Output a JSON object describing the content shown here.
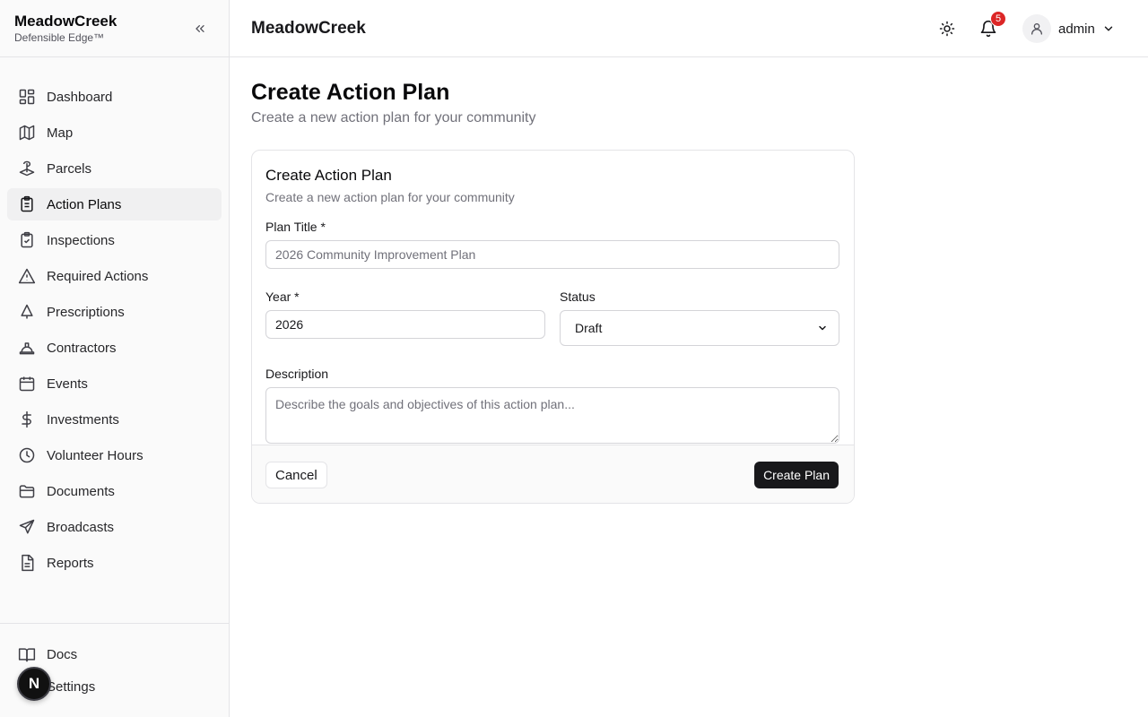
{
  "brand": {
    "name": "MeadowCreek",
    "tagline": "Defensible Edge™"
  },
  "sidebar": {
    "items": [
      {
        "label": "Dashboard",
        "icon": "dashboard-icon"
      },
      {
        "label": "Map",
        "icon": "map-icon"
      },
      {
        "label": "Parcels",
        "icon": "parcels-icon"
      },
      {
        "label": "Action Plans",
        "icon": "clipboard-icon",
        "active": true
      },
      {
        "label": "Inspections",
        "icon": "clipboard-check-icon"
      },
      {
        "label": "Required Actions",
        "icon": "warning-icon"
      },
      {
        "label": "Prescriptions",
        "icon": "tree-icon"
      },
      {
        "label": "Contractors",
        "icon": "hard-hat-icon"
      },
      {
        "label": "Events",
        "icon": "calendar-icon"
      },
      {
        "label": "Investments",
        "icon": "dollar-icon"
      },
      {
        "label": "Volunteer Hours",
        "icon": "clock-icon"
      },
      {
        "label": "Documents",
        "icon": "folder-icon"
      },
      {
        "label": "Broadcasts",
        "icon": "send-icon"
      },
      {
        "label": "Reports",
        "icon": "file-text-icon"
      }
    ],
    "bottom": [
      {
        "label": "Docs",
        "icon": "book-icon"
      },
      {
        "label": "Settings",
        "icon": "settings-icon"
      }
    ],
    "floating_avatar": "N"
  },
  "topbar": {
    "title": "MeadowCreek",
    "notifications_count": "5",
    "user": "admin"
  },
  "page": {
    "title": "Create Action Plan",
    "subtitle": "Create a new action plan for your community"
  },
  "form": {
    "card_title": "Create Action Plan",
    "card_description": "Create a new action plan for your community",
    "plan_title_label": "Plan Title *",
    "plan_title_placeholder": "2026 Community Improvement Plan",
    "year_label": "Year *",
    "year_value": "2026",
    "status_label": "Status",
    "status_value": "Draft",
    "description_label": "Description",
    "description_placeholder": "Describe the goals and objectives of this action plan...",
    "cancel_label": "Cancel",
    "submit_label": "Create Plan"
  }
}
